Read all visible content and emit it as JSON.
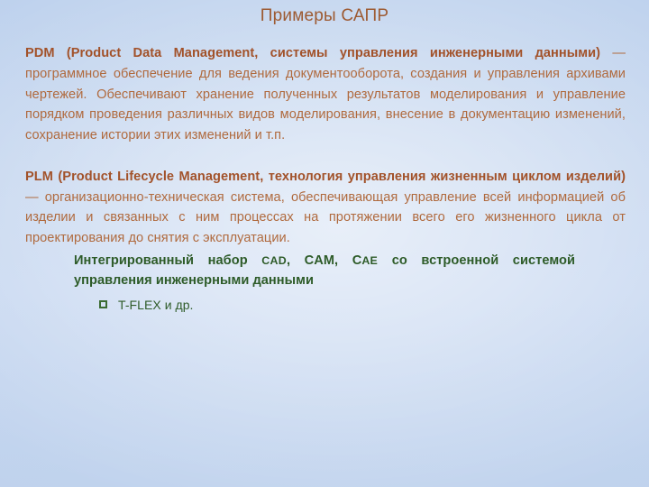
{
  "slide": {
    "title": "Примеры САПР",
    "background_color": "#c0d3ee",
    "title_color": "#9d5a32",
    "body_color": "#b06a3e",
    "bold_color": "#a2522a",
    "accent_green": "#2d5b28"
  },
  "pdm": {
    "lead": "PDM (Product Data Management, системы управления инженерными данными)",
    "dash": " — ",
    "rest": "программное обеспечение для ведения документооборота, создания и управления архивами чертежей. Обеспечивают хранение полученных результатов моделирования и управление порядком проведения различных видов моделирования, внесение в документацию изменений, сохранение истории этих изменений и т.п."
  },
  "plm": {
    "lead": "PLM (Product Lifecycle Management, технология управления жизненным циклом изделий)",
    "dash": " — ",
    "rest": "организационно-техническая система, обеспечивающая управление всей информацией об изделии и связанных с ним процессах на протяжении всего его жизненного цикла от проектирования до снятия с эксплуатации."
  },
  "green_section": {
    "head_part1": "Интегрированный набор ",
    "cad": "CAD",
    "sep1": ", ",
    "cam": "CAM",
    "sep2": ", ",
    "cae_c": "C",
    "cae_rest": "AE",
    "head_part2": " со встроенной системой управления инженерными данными",
    "bullets": [
      {
        "icon": "square-bullet-icon",
        "label": "T-FLEX и др."
      }
    ]
  }
}
